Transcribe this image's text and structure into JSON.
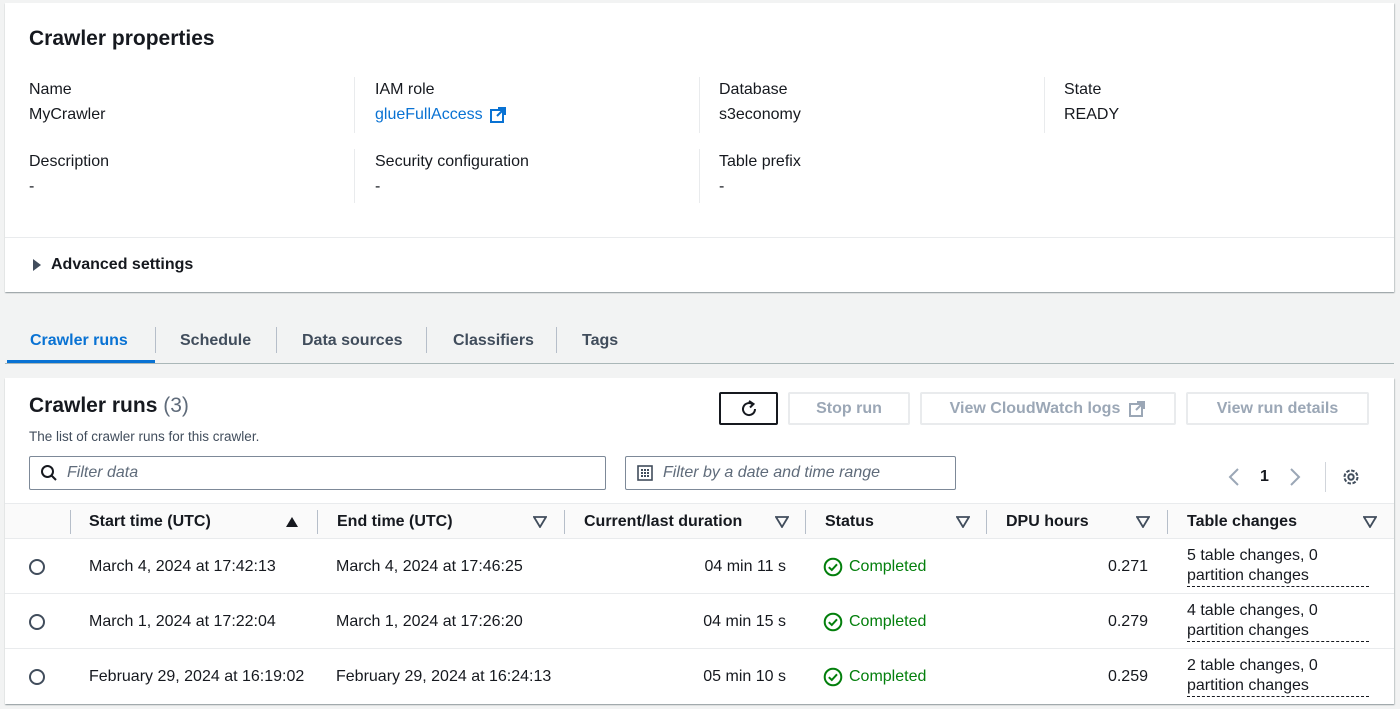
{
  "properties": {
    "title": "Crawler properties",
    "name_label": "Name",
    "name_value": "MyCrawler",
    "iam_label": "IAM role",
    "iam_value": "glueFullAccess",
    "database_label": "Database",
    "database_value": "s3economy",
    "state_label": "State",
    "state_value": "READY",
    "description_label": "Description",
    "description_value": "-",
    "security_label": "Security configuration",
    "security_value": "-",
    "prefix_label": "Table prefix",
    "prefix_value": "-",
    "advanced_label": "Advanced settings"
  },
  "tabs": [
    {
      "label": "Crawler runs",
      "active": true
    },
    {
      "label": "Schedule"
    },
    {
      "label": "Data sources"
    },
    {
      "label": "Classifiers"
    },
    {
      "label": "Tags"
    }
  ],
  "runs": {
    "title": "Crawler runs",
    "count": "(3)",
    "description": "The list of crawler runs for this crawler.",
    "stop_label": "Stop run",
    "cloudwatch_label": "View CloudWatch logs",
    "details_label": "View run details",
    "filter_placeholder": "Filter data",
    "date_placeholder": "Filter by a date and time range",
    "page": "1",
    "columns": [
      "Start time (UTC)",
      "End time (UTC)",
      "Current/last duration",
      "Status",
      "DPU hours",
      "Table changes"
    ],
    "rows": [
      {
        "start": "March 4, 2024 at 17:42:13",
        "end": "March 4, 2024 at 17:46:25",
        "duration": "04 min 11 s",
        "status": "Completed",
        "dpu": "0.271",
        "changes1": "5 table changes, 0",
        "changes2": "partition changes"
      },
      {
        "start": "March 1, 2024 at 17:22:04",
        "end": "March 1, 2024 at 17:26:20",
        "duration": "04 min 15 s",
        "status": "Completed",
        "dpu": "0.279",
        "changes1": "4 table changes, 0",
        "changes2": "partition changes"
      },
      {
        "start": "February 29, 2024 at 16:19:02",
        "end": "February 29, 2024 at 16:24:13",
        "duration": "05 min 10 s",
        "status": "Completed",
        "dpu": "0.259",
        "changes1": "2 table changes, 0",
        "changes2": "partition changes"
      }
    ]
  },
  "colors": {
    "link": "#0972d3",
    "success": "#037f0c"
  }
}
